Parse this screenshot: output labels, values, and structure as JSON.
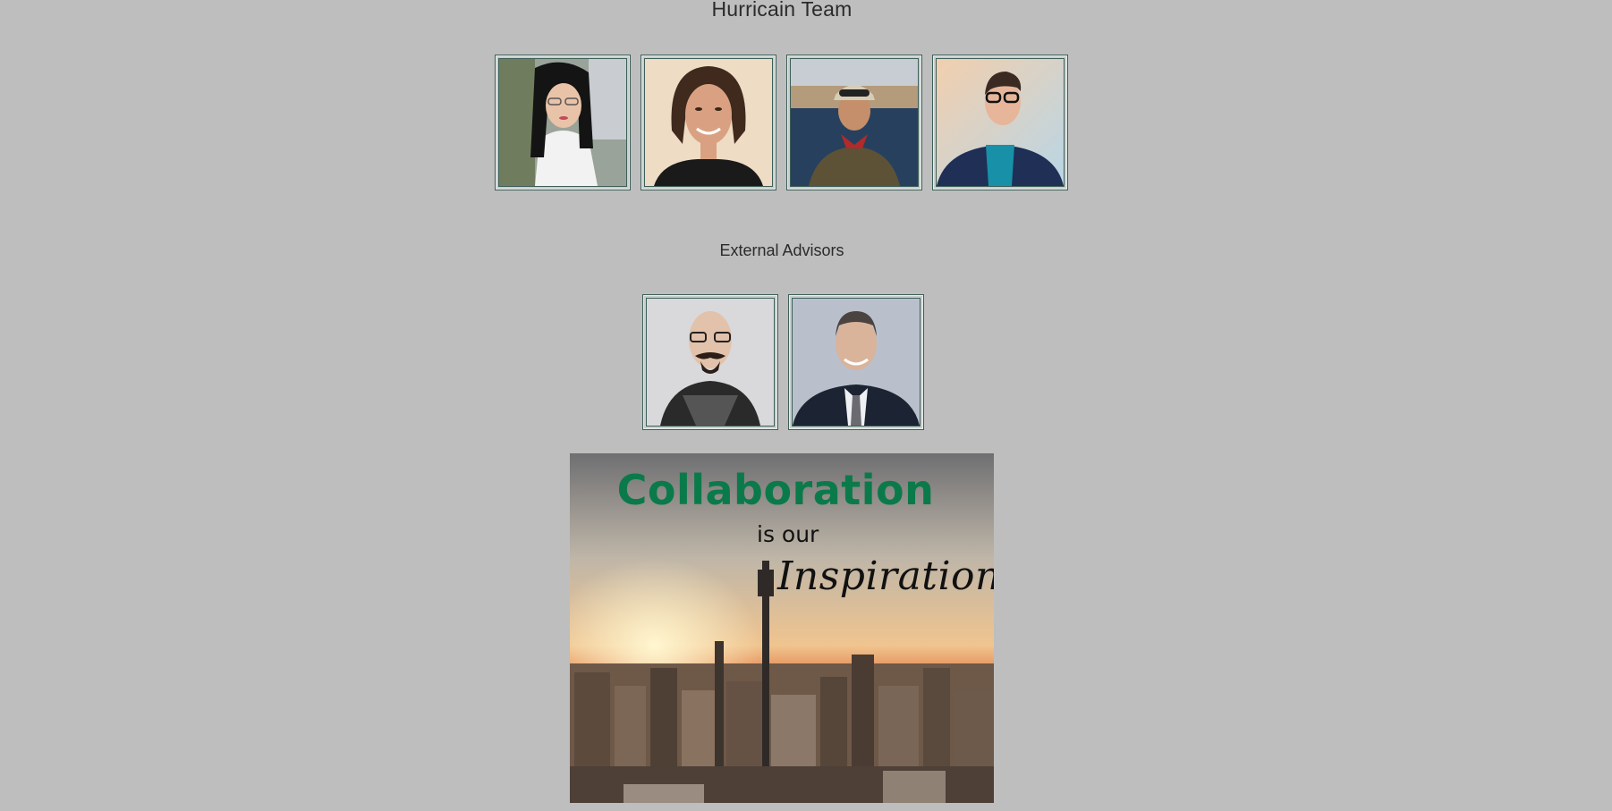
{
  "sections": {
    "team_title": "Hurricain Team",
    "advisors_title": "External Advisors"
  },
  "team_members": [
    {
      "photo": "woman-with-glasses-portrait"
    },
    {
      "photo": "smiling-woman-portrait"
    },
    {
      "photo": "woman-with-cap-by-water-portrait"
    },
    {
      "photo": "short-haired-person-with-glasses-portrait"
    }
  ],
  "advisors": [
    {
      "photo": "bald-man-with-glasses-portrait"
    },
    {
      "photo": "man-in-suit-portrait"
    }
  ],
  "poster": {
    "headline": "Collaboration",
    "subline": "is our",
    "script_word": "Inspiration",
    "headline_color": "#0b7a4a"
  },
  "colors": {
    "background": "#bebebe",
    "frame_border": "#3d5f58"
  }
}
